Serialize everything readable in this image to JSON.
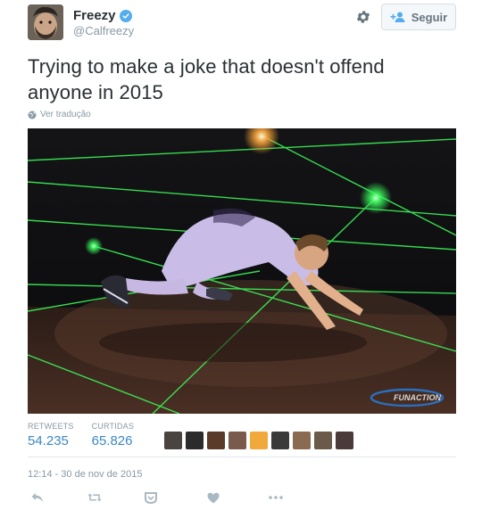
{
  "user": {
    "display_name": "Freezy",
    "handle": "@Calfreezy",
    "verified": true
  },
  "follow_button": {
    "label": "Seguir"
  },
  "tweet": {
    "line1": "Trying to make a joke that doesn't offend",
    "line2": "anyone in 2015"
  },
  "translate_link": "Ver tradução",
  "media": {
    "watermark": "FUNACTION"
  },
  "stats": {
    "retweets_label": "RETWEETS",
    "retweets_value": "54.235",
    "likes_label": "CURTIDAS",
    "likes_value": "65.826"
  },
  "likers": [
    {
      "icon": "avatar-1",
      "color": "#4a4440"
    },
    {
      "icon": "avatar-2",
      "color": "#2b2b2b"
    },
    {
      "icon": "avatar-3",
      "color": "#5a3b2a"
    },
    {
      "icon": "avatar-4",
      "color": "#7a5a4a"
    },
    {
      "icon": "avatar-5",
      "color": "#f2a93b"
    },
    {
      "icon": "avatar-6",
      "color": "#3a3a3a"
    },
    {
      "icon": "avatar-7",
      "color": "#8a6a50"
    },
    {
      "icon": "avatar-8",
      "color": "#6b5a4a"
    },
    {
      "icon": "avatar-9",
      "color": "#4a3a3a"
    }
  ],
  "timestamp": "12:14 - 30 de nov de 2015",
  "actions": {
    "reply": "reply-icon",
    "retweet": "retweet-icon",
    "like": "heart-icon",
    "more": "more-icon",
    "save": "bookmark-icon"
  },
  "colors": {
    "accent": "#55acee",
    "stat_value": "#3b88c3",
    "muted": "#8899a6",
    "laser": "#37ff5a"
  }
}
